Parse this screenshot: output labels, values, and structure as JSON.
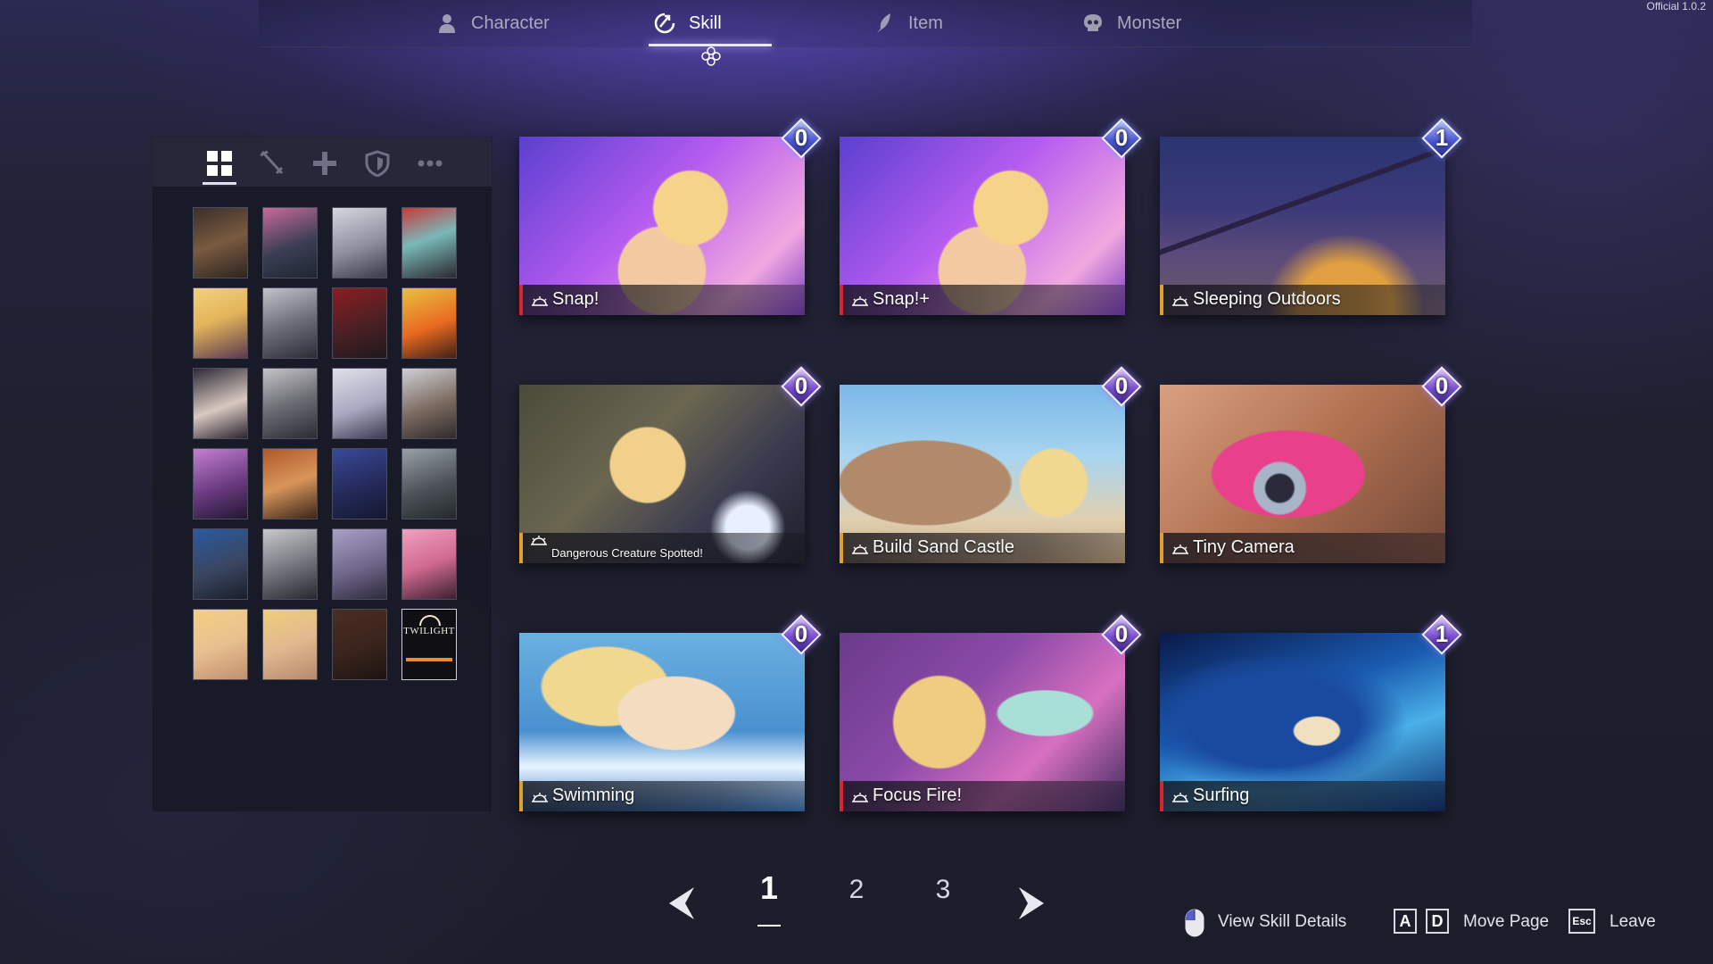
{
  "version": "Official 1.0.2",
  "tabs": [
    {
      "label": "Character",
      "icon": "person-icon"
    },
    {
      "label": "Skill",
      "icon": "skill-icon"
    },
    {
      "label": "Item",
      "icon": "quill-icon"
    },
    {
      "label": "Monster",
      "icon": "skull-icon"
    }
  ],
  "active_tab": "Skill",
  "filters": [
    {
      "icon": "grid-icon",
      "active": true
    },
    {
      "icon": "sword-icon",
      "active": false
    },
    {
      "icon": "plus-icon",
      "active": false
    },
    {
      "icon": "shield-icon",
      "active": false
    },
    {
      "icon": "more-icon",
      "active": false
    }
  ],
  "portraits": {
    "twilight_label": "TWILIGHT"
  },
  "cards": [
    {
      "name": "Snap!",
      "cost": "0",
      "stripe": "#d8262e",
      "gem": "blue"
    },
    {
      "name": "Snap!+",
      "cost": "0",
      "stripe": "#d8262e",
      "gem": "blue"
    },
    {
      "name": "Sleeping Outdoors",
      "cost": "1",
      "stripe": "#e0a02a",
      "gem": "blue"
    },
    {
      "name": "Dangerous Creature Spotted!",
      "cost": "0",
      "stripe": "#e0a02a",
      "gem": "purple"
    },
    {
      "name": "Build Sand Castle",
      "cost": "0",
      "stripe": "#e0a02a",
      "gem": "purple"
    },
    {
      "name": "Tiny Camera",
      "cost": "0",
      "stripe": "#e0a02a",
      "gem": "purple"
    },
    {
      "name": "Swimming",
      "cost": "0",
      "stripe": "#e0a02a",
      "gem": "purple"
    },
    {
      "name": "Focus Fire!",
      "cost": "0",
      "stripe": "#d8262e",
      "gem": "purple"
    },
    {
      "name": "Surfing",
      "cost": "1",
      "stripe": "#d8262e",
      "gem": "purple"
    }
  ],
  "pagination": {
    "pages": [
      "1",
      "2",
      "3"
    ],
    "current": "1"
  },
  "hints": {
    "view_details": "View Skill Details",
    "key_a": "A",
    "key_d": "D",
    "move_page": "Move Page",
    "key_esc": "Esc",
    "leave": "Leave"
  }
}
